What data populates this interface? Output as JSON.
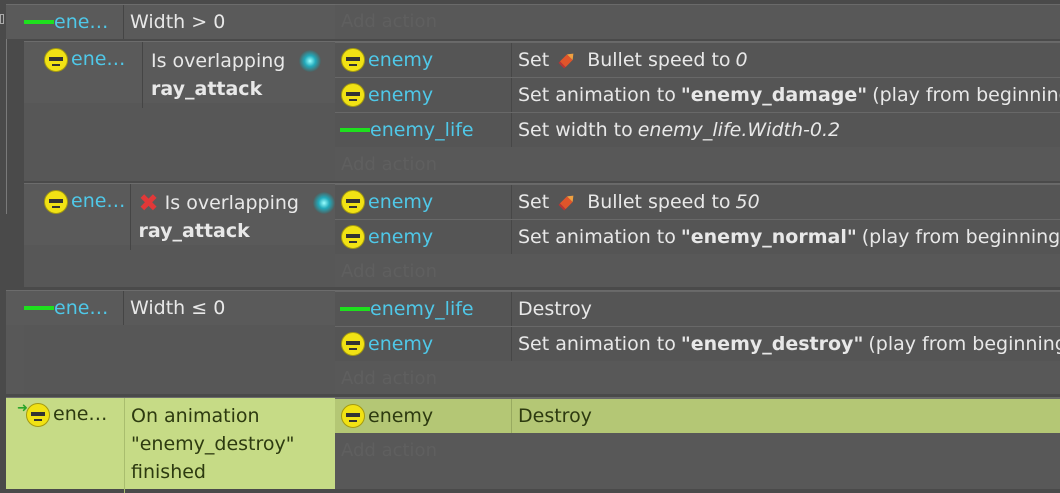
{
  "colors": {
    "object_name": "#4fc8e8",
    "selected_event": "#c6db86",
    "selected_action": "#b4c775",
    "bar_icon": "#1ee01e"
  },
  "add_action_label": "Add action",
  "events": [
    {
      "object": "ene…",
      "icon": "green-bar-icon",
      "condition": "Width > 0",
      "actions": []
    },
    {
      "object": "ene…",
      "icon": "enemy-face-icon",
      "condition_prefix": "Is overlapping",
      "condition_bold": "ray_attack",
      "actions": [
        {
          "object": "enemy",
          "icon": "enemy-face-icon",
          "prefix": "Set",
          "mid": "Bullet speed to",
          "value": "0"
        },
        {
          "object": "enemy",
          "icon": "enemy-face-icon",
          "prefix": "Set animation to",
          "bold": "\"enemy_damage\"",
          "suffix": "(play from beginning)"
        },
        {
          "object": "enemy_life",
          "icon": "green-bar-icon",
          "prefix": "Set width to",
          "value": "enemy_life.Width-0.2"
        }
      ]
    },
    {
      "object": "ene…",
      "icon": "enemy-face-icon",
      "inverted": true,
      "condition_prefix": "Is overlapping",
      "condition_bold": "ray_attack",
      "actions": [
        {
          "object": "enemy",
          "icon": "enemy-face-icon",
          "prefix": "Set",
          "mid": "Bullet speed to",
          "value": "50"
        },
        {
          "object": "enemy",
          "icon": "enemy-face-icon",
          "prefix": "Set animation to",
          "bold": "\"enemy_normal\"",
          "suffix": "(play from beginning)"
        }
      ]
    },
    {
      "object": "ene…",
      "icon": "green-bar-icon",
      "condition": "Width ≤ 0",
      "actions": [
        {
          "object": "enemy_life",
          "icon": "green-bar-icon",
          "prefix": "Destroy"
        },
        {
          "object": "enemy",
          "icon": "enemy-face-icon",
          "prefix": "Set animation to",
          "bold": "\"enemy_destroy\"",
          "suffix": "(play from beginning)"
        }
      ]
    },
    {
      "object": "ene…",
      "icon": "enemy-face-icon",
      "selected": true,
      "trigger": true,
      "condition_lines": [
        "On animation",
        "\"enemy_destroy\"",
        "finished"
      ],
      "actions": [
        {
          "object": "enemy",
          "icon": "enemy-face-icon",
          "prefix": "Destroy",
          "selected": true
        }
      ]
    }
  ]
}
